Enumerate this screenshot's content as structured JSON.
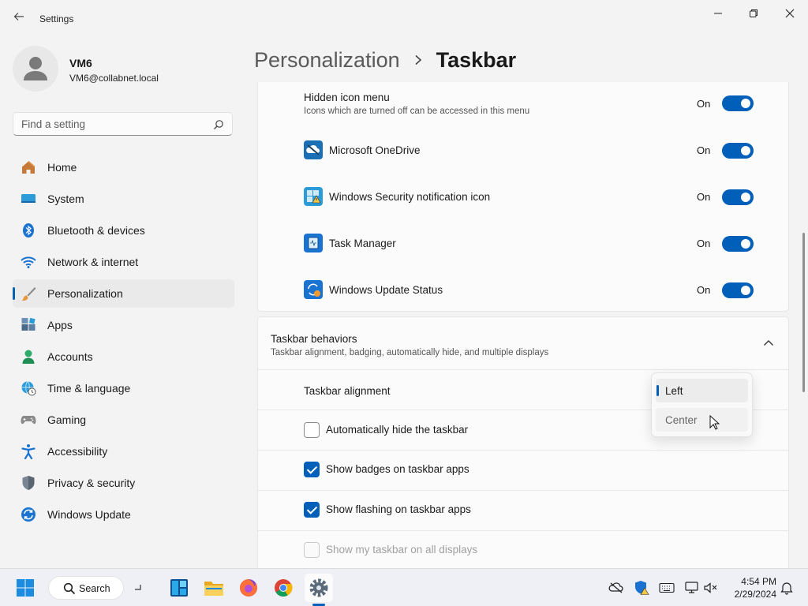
{
  "window": {
    "title": "Settings"
  },
  "profile": {
    "name": "VM6",
    "email": "VM6@collabnet.local"
  },
  "search": {
    "placeholder": "Find a setting"
  },
  "nav": {
    "items": [
      {
        "label": "Home",
        "icon": "home-icon"
      },
      {
        "label": "System",
        "icon": "system-icon"
      },
      {
        "label": "Bluetooth & devices",
        "icon": "bluetooth-icon"
      },
      {
        "label": "Network & internet",
        "icon": "wifi-icon"
      },
      {
        "label": "Personalization",
        "icon": "brush-icon",
        "selected": true
      },
      {
        "label": "Apps",
        "icon": "apps-icon"
      },
      {
        "label": "Accounts",
        "icon": "accounts-icon"
      },
      {
        "label": "Time & language",
        "icon": "globe-clock-icon"
      },
      {
        "label": "Gaming",
        "icon": "gamepad-icon"
      },
      {
        "label": "Accessibility",
        "icon": "accessibility-icon"
      },
      {
        "label": "Privacy & security",
        "icon": "shield-icon"
      },
      {
        "label": "Windows Update",
        "icon": "update-icon"
      }
    ]
  },
  "header": {
    "parent": "Personalization",
    "current": "Taskbar"
  },
  "hidden_icons": {
    "title": "Hidden icon menu",
    "subtitle": "Icons which are turned off can be accessed in this menu",
    "state": "On",
    "items": [
      {
        "label": "Microsoft OneDrive",
        "state": "On",
        "icon": "onedrive-icon"
      },
      {
        "label": "Windows Security notification icon",
        "state": "On",
        "icon": "windows-security-icon"
      },
      {
        "label": "Task Manager",
        "state": "On",
        "icon": "task-manager-icon"
      },
      {
        "label": "Windows Update Status",
        "state": "On",
        "icon": "update-status-icon"
      }
    ]
  },
  "behaviors": {
    "title": "Taskbar behaviors",
    "subtitle": "Taskbar alignment, badging, automatically hide, and multiple displays",
    "alignment_label": "Taskbar alignment",
    "options": [
      {
        "label": "Automatically hide the taskbar",
        "checked": false,
        "enabled": true
      },
      {
        "label": "Show badges on taskbar apps",
        "checked": true,
        "enabled": true
      },
      {
        "label": "Show flashing on taskbar apps",
        "checked": true,
        "enabled": true
      },
      {
        "label": "Show my taskbar on all displays",
        "checked": false,
        "enabled": false
      }
    ]
  },
  "alignment_dropdown": {
    "options": [
      "Left",
      "Center"
    ],
    "selected": "Left",
    "hovered": "Center"
  },
  "taskbar": {
    "search_label": "Search",
    "time": "4:54 PM",
    "date": "2/29/2024"
  },
  "colors": {
    "accent": "#005fb8",
    "background": "#f3f3f3",
    "card": "#fbfbfb"
  }
}
